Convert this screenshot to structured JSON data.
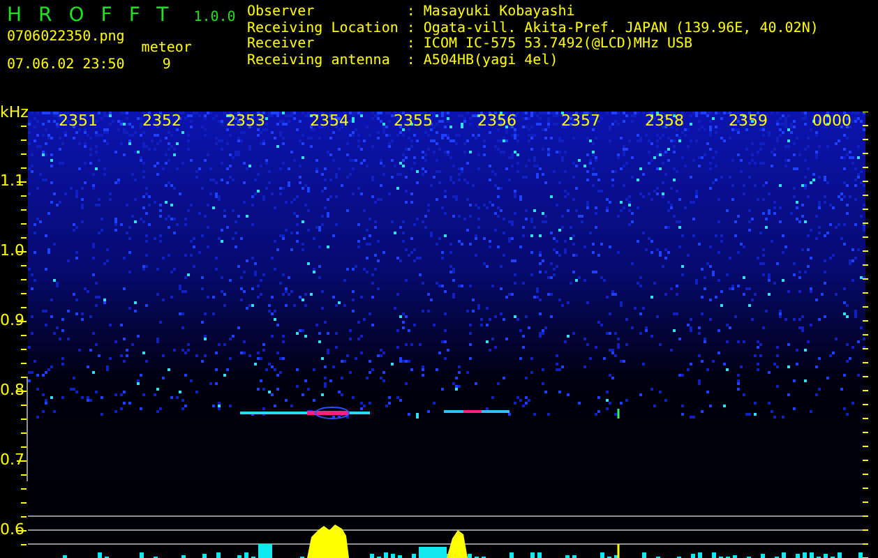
{
  "app": {
    "name": "HROFFT",
    "version": "1.0.0"
  },
  "file": "0706022350.png",
  "datetime": "07.06.02 23:50",
  "meteor": {
    "label": "meteor",
    "count": "9"
  },
  "info": [
    {
      "label": "Observer",
      "separator": ":",
      "value": "Masayuki Kobayashi"
    },
    {
      "label": "Receiving Location",
      "separator": ":",
      "value": "Ogata-vill. Akita-Pref. JAPAN (139.96E, 40.02N)"
    },
    {
      "label": "Receiver",
      "separator": ":",
      "value": "ICOM IC-575 53.7492(@LCD)MHz USB"
    },
    {
      "label": "Receiving antenna",
      "separator": ":",
      "value": "A504HB(yagi 4el)"
    }
  ],
  "spectrogram": {
    "unit": "kHz",
    "time_labels": [
      "2351",
      "2352",
      "2353",
      "2354",
      "2355",
      "2356",
      "2357",
      "2358",
      "2359",
      "0000"
    ],
    "freq_labels": [
      "1.1",
      "1.0",
      "0.9",
      "0.8",
      "0.7",
      "0.6"
    ]
  }
}
